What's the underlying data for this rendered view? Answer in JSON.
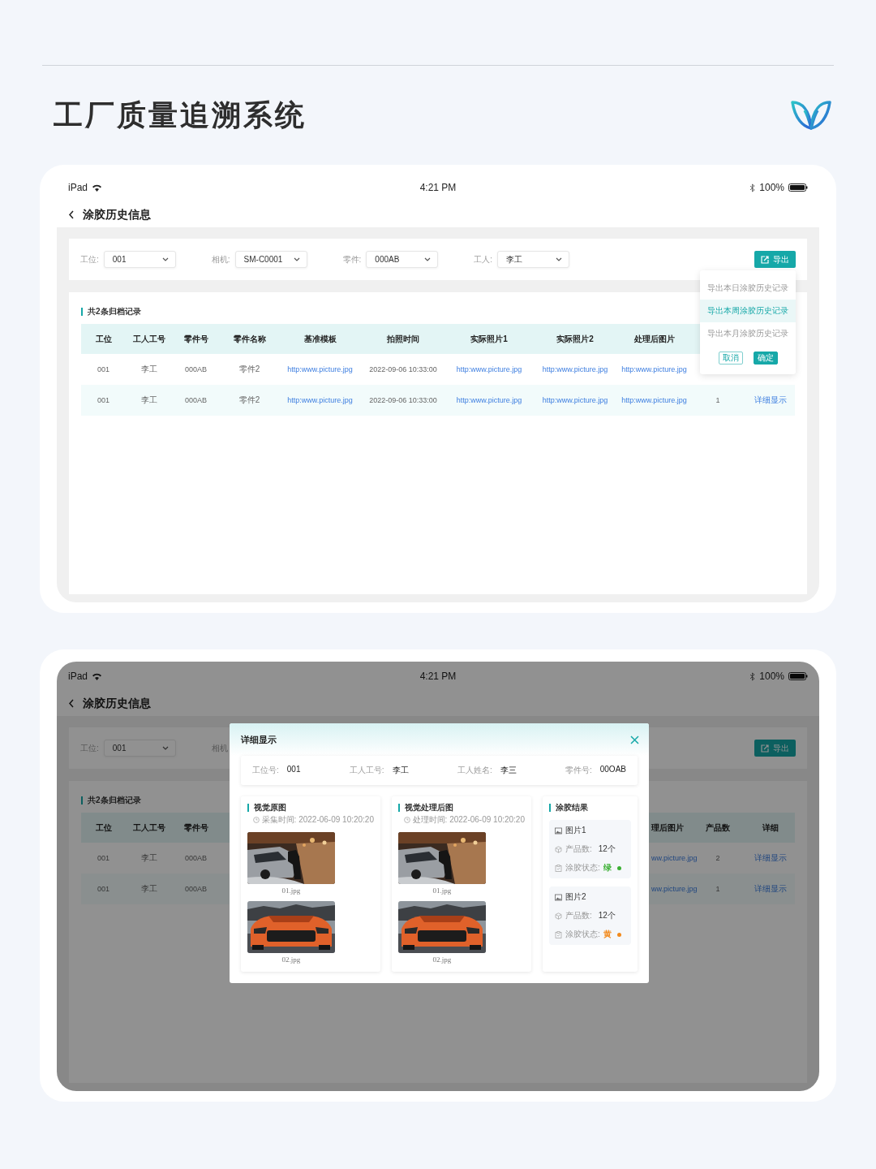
{
  "header": {
    "title": "工厂质量追溯系统"
  },
  "screens": [
    {
      "dimmed": false,
      "status_bar": {
        "device": "iPad",
        "time": "4:21 PM",
        "battery": "100%"
      },
      "nav": {
        "title": "涂胶历史信息"
      },
      "filters": [
        {
          "label": "工位:",
          "value": "001"
        },
        {
          "label": "相机:",
          "value": "SM-C0001"
        },
        {
          "label": "零件:",
          "value": "000AB"
        },
        {
          "label": "工人:",
          "value": "李工"
        }
      ],
      "export_button": {
        "label": "导出"
      },
      "export_menu": {
        "items": [
          {
            "label": "导出本日涂胶历史记录",
            "selected": false
          },
          {
            "label": "导出本周涂胶历史记录",
            "selected": true
          },
          {
            "label": "导出本月涂胶历史记录",
            "selected": false
          }
        ],
        "buttons": [
          {
            "label": "取消",
            "kind": "secondary"
          },
          {
            "label": "确定",
            "kind": "primary"
          }
        ]
      },
      "records_title": "共2条归档记录",
      "table": {
        "columns": [
          {
            "label": "工位"
          },
          {
            "label": "工人工号"
          },
          {
            "label": "零件号"
          },
          {
            "label": "零件名称"
          },
          {
            "label": "基准模板"
          },
          {
            "label": "拍照时间"
          },
          {
            "label": "实际照片1"
          },
          {
            "label": "实际照片2"
          },
          {
            "label": "处理后图片"
          }
        ],
        "rows": [
          {
            "cells": [
              {
                "text": "001",
                "kind": "text"
              },
              {
                "text": "李工",
                "kind": "text"
              },
              {
                "text": "000AB",
                "kind": "text"
              },
              {
                "text": "零件2",
                "kind": "text"
              },
              {
                "text": "http:www.picture.jpg",
                "kind": "link"
              },
              {
                "text": "2022-09-06  10:33:00",
                "kind": "text"
              },
              {
                "text": "http:www.picture.jpg",
                "kind": "link"
              },
              {
                "text": "http:www.picture.jpg",
                "kind": "link"
              },
              {
                "text": "http:www.picture.jpg",
                "kind": "link"
              }
            ]
          },
          {
            "cells": [
              {
                "text": "001",
                "kind": "text"
              },
              {
                "text": "李工",
                "kind": "text"
              },
              {
                "text": "000AB",
                "kind": "text"
              },
              {
                "text": "零件2",
                "kind": "text"
              },
              {
                "text": "http:www.picture.jpg",
                "kind": "link"
              },
              {
                "text": "2022-09-06  10:33:00",
                "kind": "text"
              },
              {
                "text": "http:www.picture.jpg",
                "kind": "link"
              },
              {
                "text": "http:www.picture.jpg",
                "kind": "link"
              },
              {
                "text": "http:www.picture.jpg",
                "kind": "link"
              },
              {
                "text": "1",
                "kind": "text"
              },
              {
                "text": "详细显示",
                "kind": "detail"
              }
            ]
          }
        ]
      }
    },
    {
      "dimmed": true,
      "status_bar": {
        "device": "iPad",
        "time": "4:21 PM",
        "battery": "100%"
      },
      "nav": {
        "title": "涂胶历史信息"
      },
      "filters": [
        {
          "label": "工位:",
          "value": "001"
        },
        {
          "label": "相机"
        }
      ],
      "export_button": {
        "label": "导出"
      },
      "records_title": "共2条归档记录",
      "table": {
        "left_columns": [
          {
            "label": "工位"
          },
          {
            "label": "工人工号"
          },
          {
            "label": "零件号"
          }
        ],
        "right_columns": [
          {
            "label": "理后图片"
          },
          {
            "label": "产品数"
          },
          {
            "label": "详细"
          }
        ],
        "rows": [
          {
            "left_cells": [
              {
                "text": "001",
                "kind": "text"
              },
              {
                "text": "李工",
                "kind": "text"
              },
              {
                "text": "000AB",
                "kind": "text"
              }
            ],
            "right_cells": [
              {
                "text": "ww.picture.jpg",
                "kind": "link"
              },
              {
                "text": "2",
                "kind": "text"
              },
              {
                "text": "详细显示",
                "kind": "detail"
              }
            ]
          },
          {
            "left_cells": [
              {
                "text": "001",
                "kind": "text"
              },
              {
                "text": "李工",
                "kind": "text"
              },
              {
                "text": "000AB",
                "kind": "text"
              }
            ],
            "right_cells": [
              {
                "text": "ww.picture.jpg",
                "kind": "link"
              },
              {
                "text": "1",
                "kind": "text"
              },
              {
                "text": "详细显示",
                "kind": "detail"
              }
            ]
          }
        ]
      },
      "modal": {
        "title": "详细显示",
        "info": [
          {
            "label": "工位号:",
            "value": "001"
          },
          {
            "label": "工人工号:",
            "value": "李工"
          },
          {
            "label": "工人姓名:",
            "value": "李三"
          },
          {
            "label": "零件号:",
            "value": "00OAB"
          }
        ],
        "panels": [
          {
            "kind": "images",
            "title": "视觉原图",
            "time": "采集时间: 2022-06-09  10:20:20",
            "images": [
              {
                "kind": "picture",
                "caption": "01.jpg"
              },
              {
                "kind": "picture",
                "caption": "02.jpg"
              }
            ]
          },
          {
            "kind": "images",
            "title": "视觉处理后图",
            "time": "处理时间: 2022-06-09  10:20:20",
            "images": [
              {
                "kind": "picture",
                "caption": "01.jpg"
              },
              {
                "kind": "picture",
                "caption": "02.jpg"
              }
            ]
          },
          {
            "kind": "results",
            "title": "涂胶结果",
            "items": [
              {
                "title": "图片1",
                "count_label": "产品数:",
                "count": "12个",
                "status_label": "涂胶状态:",
                "status": "绿",
                "color": "#3cb034"
              },
              {
                "title": "图片2",
                "count_label": "产品数:",
                "count": "12个",
                "status_label": "涂胶状态:",
                "status": "黄",
                "color": "#f28a1c"
              }
            ]
          }
        ]
      }
    }
  ]
}
